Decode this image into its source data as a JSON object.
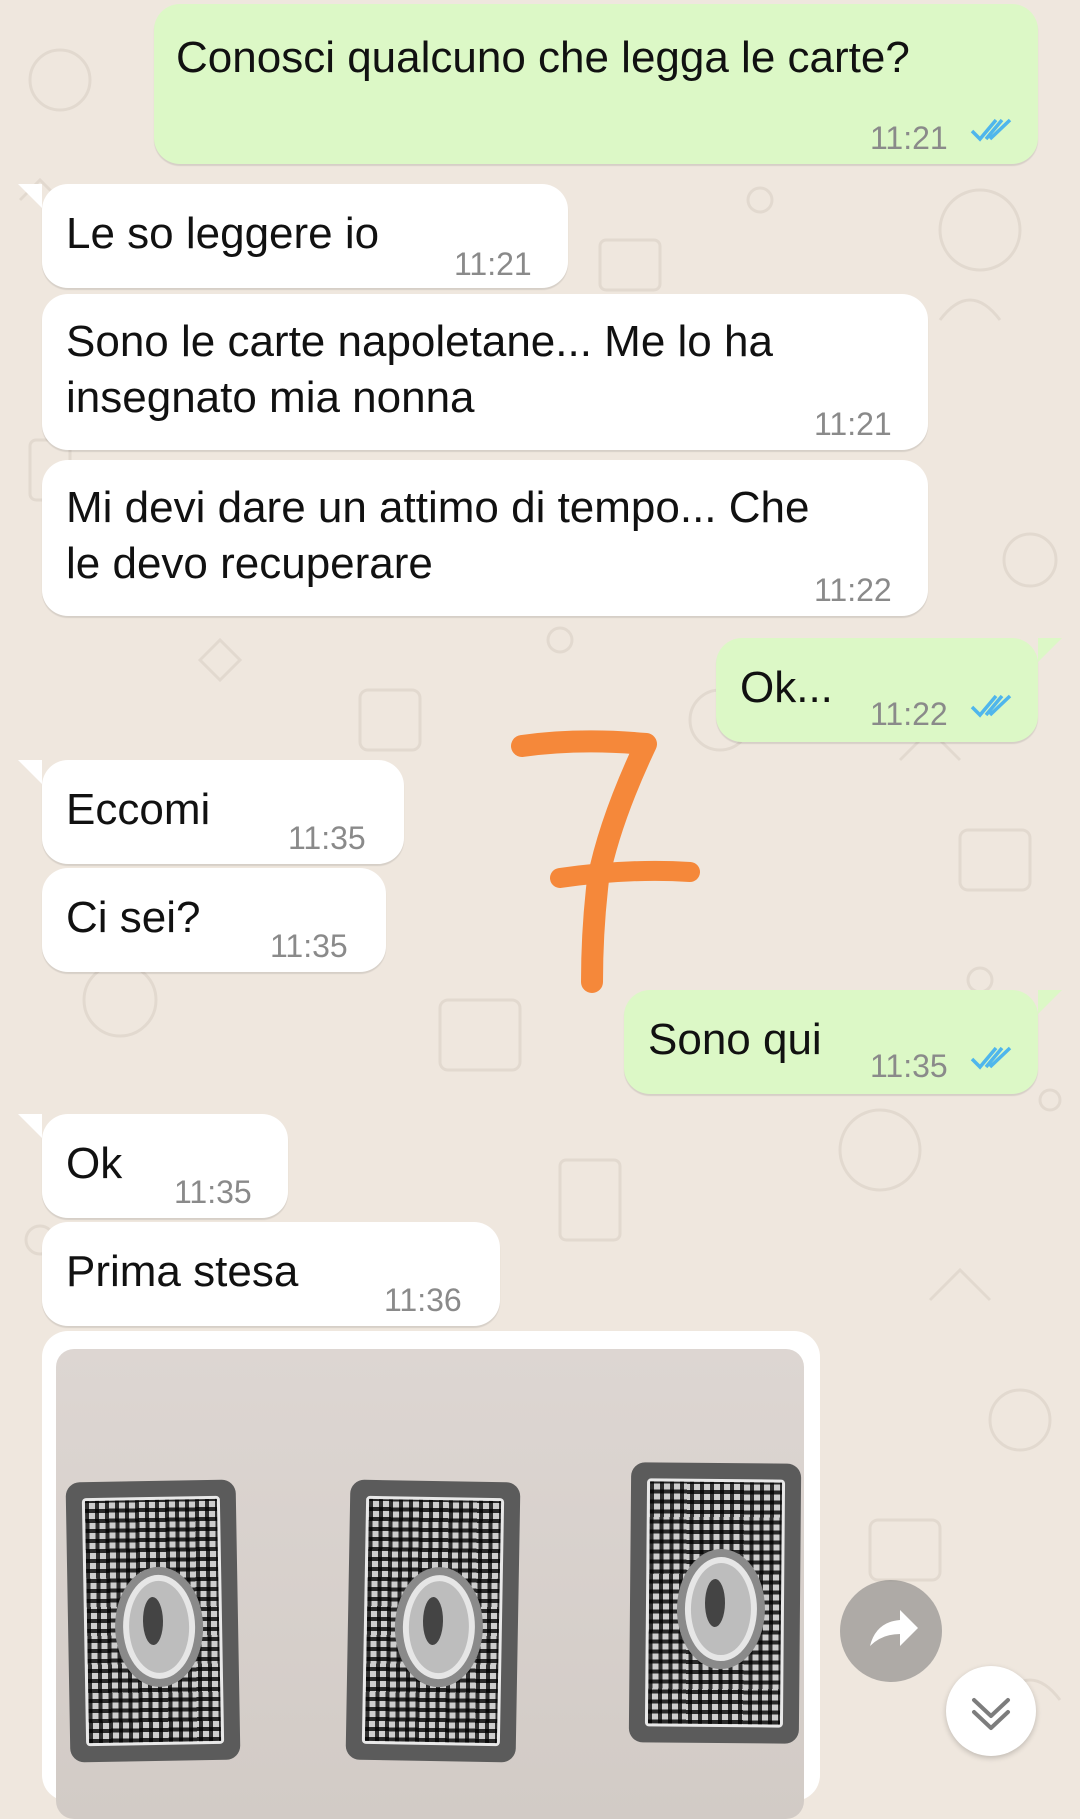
{
  "messages": [
    {
      "id": "m1",
      "direction": "out",
      "text": "Conosci qualcuno che legga le carte?",
      "time": "11:21",
      "status": "read"
    },
    {
      "id": "m2",
      "direction": "in",
      "text": "Le so leggere io",
      "time": "11:21"
    },
    {
      "id": "m3",
      "direction": "in",
      "text_line1": "Sono le carte napoletane... Me lo ha",
      "text_line2": "insegnato mia nonna",
      "time": "11:21"
    },
    {
      "id": "m4",
      "direction": "in",
      "text_line1": "Mi devi dare un attimo di tempo... Che",
      "text_line2": "le devo recuperare",
      "time": "11:22"
    },
    {
      "id": "m5",
      "direction": "out",
      "text": "Ok...",
      "time": "11:22",
      "status": "read"
    },
    {
      "id": "m6",
      "direction": "in",
      "text": "Eccomi",
      "time": "11:35"
    },
    {
      "id": "m7",
      "direction": "in",
      "text": "Ci sei?",
      "time": "11:35"
    },
    {
      "id": "m8",
      "direction": "out",
      "text": "Sono qui",
      "time": "11:35",
      "status": "read"
    },
    {
      "id": "m9",
      "direction": "in",
      "text": "Ok",
      "time": "11:35"
    },
    {
      "id": "m10",
      "direction": "in",
      "text": "Prima stesa",
      "time": "11:36"
    },
    {
      "id": "m11",
      "direction": "in",
      "type": "image",
      "image_content": "three playing cards face down"
    }
  ],
  "annotation": {
    "text": "7",
    "color": "#f5883a"
  },
  "colors": {
    "incoming": "#ffffff",
    "outgoing": "#dcf8c6",
    "read_ticks": "#4fb6ec",
    "background": "#efe7de"
  },
  "icons": {
    "forward": "forward-arrow-icon",
    "scroll_down": "chevron-down-icon"
  }
}
